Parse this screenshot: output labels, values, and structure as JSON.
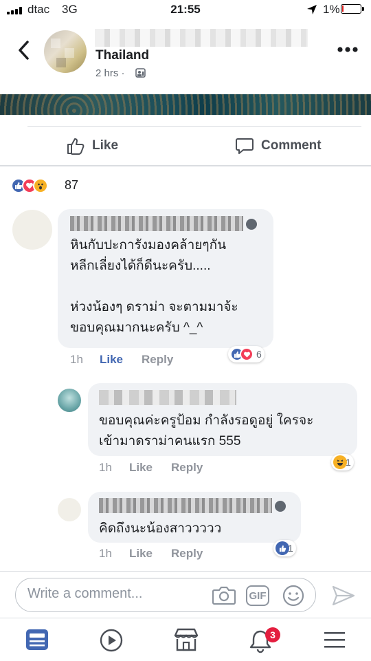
{
  "status_bar": {
    "carrier": "dtac",
    "network": "3G",
    "time": "21:55",
    "battery": "1%"
  },
  "post": {
    "location": "Thailand",
    "time": "2 hrs ·"
  },
  "actions": {
    "like": "Like",
    "comment": "Comment"
  },
  "reactions": {
    "count": "87"
  },
  "comments": [
    {
      "text": "หินกับปะการังมองคล้ายๆกัน\nหลีกเลี่ยงได้ก็ดีนะครับ.....\n\nห่วงน้องๆ ดราม่า จะตามมาจ้ะ\nขอบคุณมากนะครับ ^_^",
      "time": "1h",
      "like": "Like",
      "reply": "Reply",
      "reaction_count": "6"
    },
    {
      "text": "ขอบคุณค่ะครูป้อม กำลังรอดูอยู่ ใครจะ\nเข้ามาดราม่าคนแรก 555",
      "time": "1h",
      "like": "Like",
      "reply": "Reply",
      "reaction_count": "1"
    },
    {
      "text": "คิดถึงนะน้องสาววววว",
      "time": "1h",
      "like": "Like",
      "reply": "Reply",
      "reaction_count": "1"
    }
  ],
  "composer": {
    "placeholder": "Write a comment..."
  },
  "tabbar": {
    "notification_badge": "3"
  },
  "colors": {
    "facebook_blue": "#4267b2",
    "love_red": "#f33e58",
    "haha_yellow": "#f7b125",
    "badge_red": "#e41e3f"
  }
}
